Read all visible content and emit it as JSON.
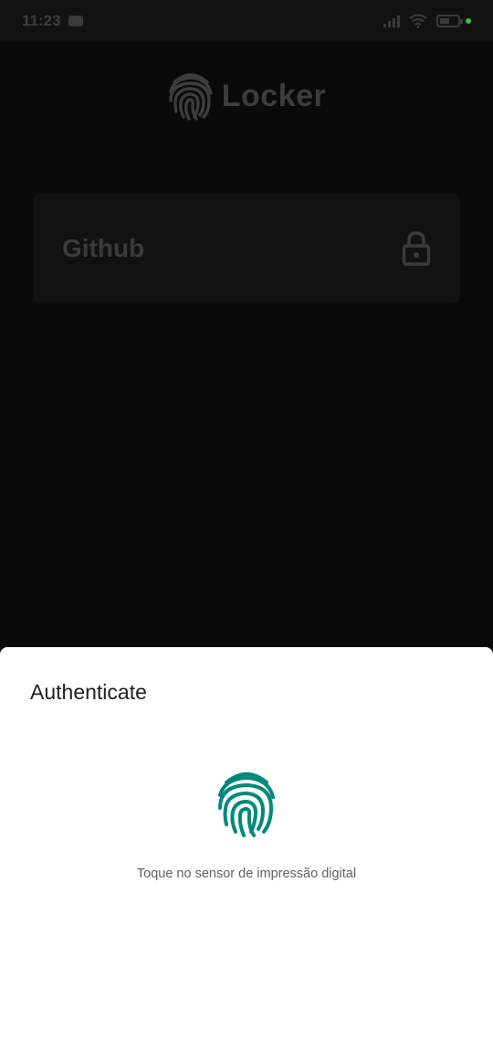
{
  "status_bar": {
    "time": "11:23",
    "battery_dot_color": "#3cba3c"
  },
  "header": {
    "title": "Locker",
    "logo_icon": "fingerprint-icon"
  },
  "cards": [
    {
      "label": "Github",
      "icon": "lock-icon"
    }
  ],
  "auth_sheet": {
    "title": "Authenticate",
    "icon": "fingerprint-icon",
    "icon_color": "#00897b",
    "hint": "Toque no sensor de impressão digital"
  }
}
